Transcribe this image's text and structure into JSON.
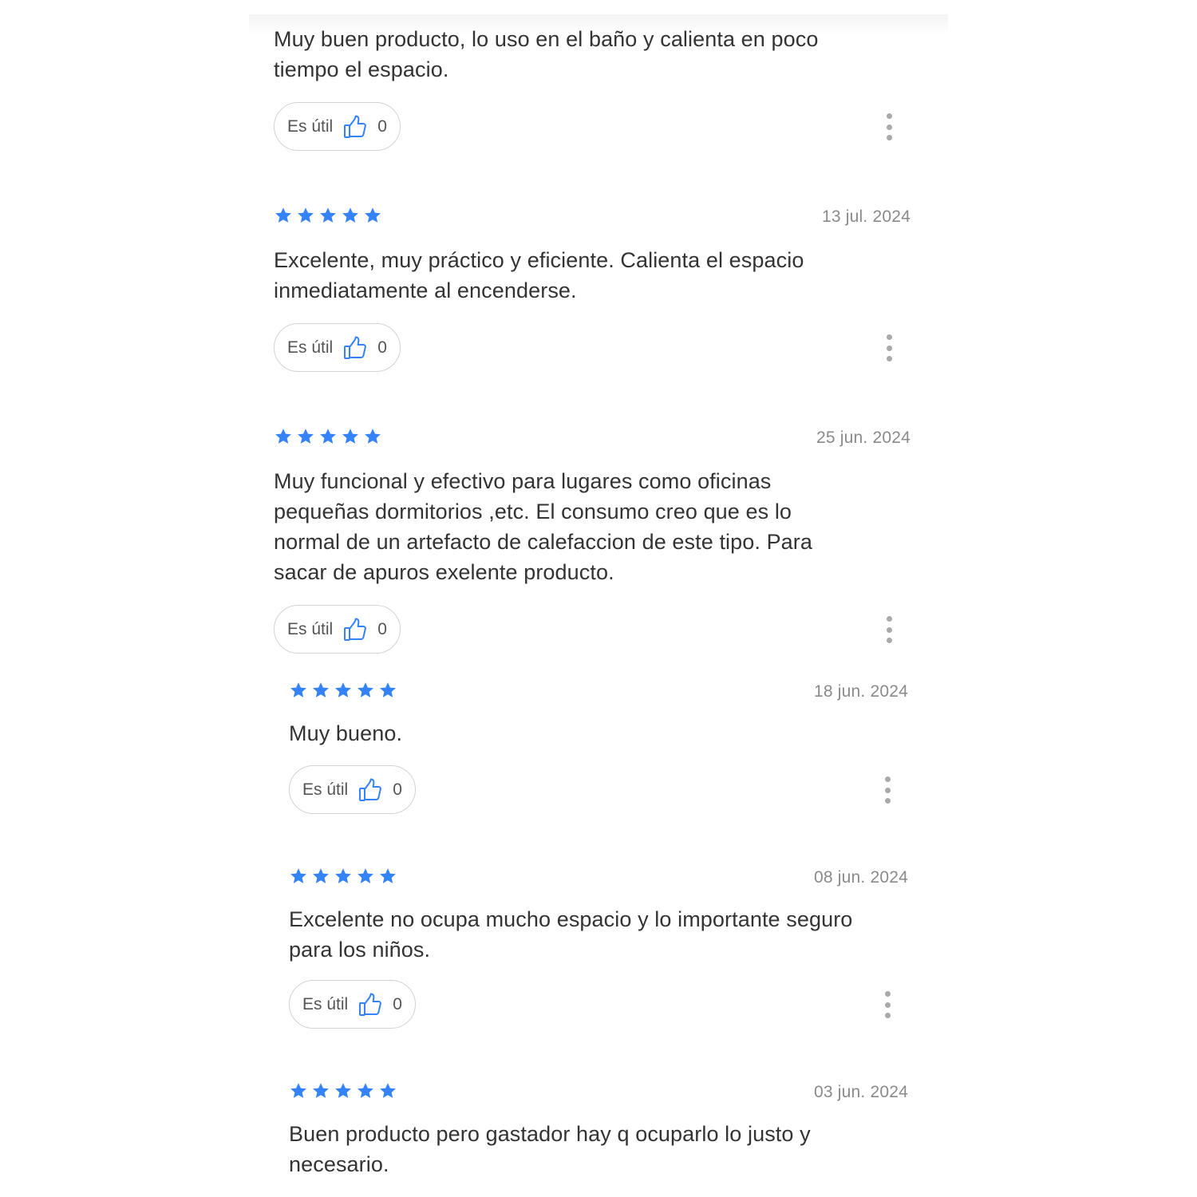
{
  "colors": {
    "star": "#3483fa",
    "thumb": "#3483fa",
    "text": "#333333",
    "date": "#8a8a8a"
  },
  "helpful_label": "Es útil",
  "icons": {
    "rating": "star-icon",
    "helpful": "thumbs-up-icon",
    "more": "more-vert-icon"
  },
  "reviews": [
    {
      "stars": null,
      "date": null,
      "text": [
        "Muy buen producto, lo uso en el baño y calienta en poco",
        "tiempo el espacio."
      ],
      "helpful_count": "0"
    },
    {
      "stars": 5,
      "date": "13 jul. 2024",
      "text": [
        "Excelente, muy práctico y eficiente. Calienta el espacio",
        "inmediatamente al encenderse."
      ],
      "helpful_count": "0"
    },
    {
      "stars": 5,
      "date": "25 jun. 2024",
      "text": [
        "Muy funcional y efectivo para lugares como oficinas",
        "pequeñas dormitorios ,etc. El consumo creo que es lo",
        "normal de un artefacto de calefaccion de este tipo. Para",
        "sacar de apuros exelente producto."
      ],
      "helpful_count": "0"
    },
    {
      "stars": 5,
      "date": "18 jun. 2024",
      "text": [
        "Muy bueno."
      ],
      "helpful_count": "0"
    },
    {
      "stars": 5,
      "date": "08 jun. 2024",
      "text": [
        "Excelente no ocupa mucho espacio y lo importante seguro",
        "para los niños."
      ],
      "helpful_count": "0"
    },
    {
      "stars": 5,
      "date": "03 jun. 2024",
      "text": [
        "Buen producto pero gastador hay q ocuparlo lo justo y",
        "necesario."
      ],
      "helpful_count": null
    }
  ]
}
